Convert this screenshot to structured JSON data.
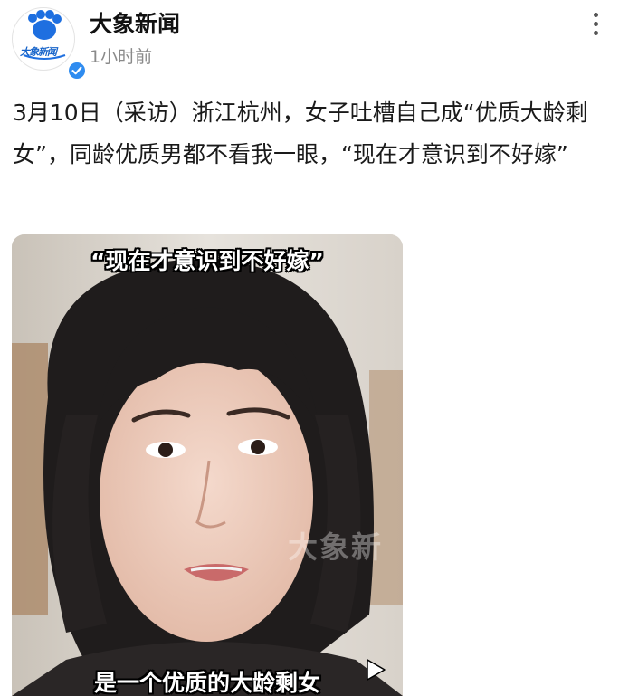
{
  "header": {
    "avatar_text": "大象新闻",
    "account_name": "大象新闻",
    "timestamp": "1小时前",
    "more_icon": "more-vertical-icon",
    "verified_icon": "verified-check-icon",
    "brand_color": "#1e6fe0"
  },
  "post": {
    "text": "3月10日（采访）浙江杭州，女子吐槽自己成“优质大龄剩女”，同龄优质男都不看我一眼，“现在才意识到不好嫁”"
  },
  "video": {
    "caption_top": "“现在才意识到不好嫁”",
    "caption_bottom": "是一个优质的大龄剩女",
    "watermark": "大象新",
    "play_icon": "play-icon"
  }
}
